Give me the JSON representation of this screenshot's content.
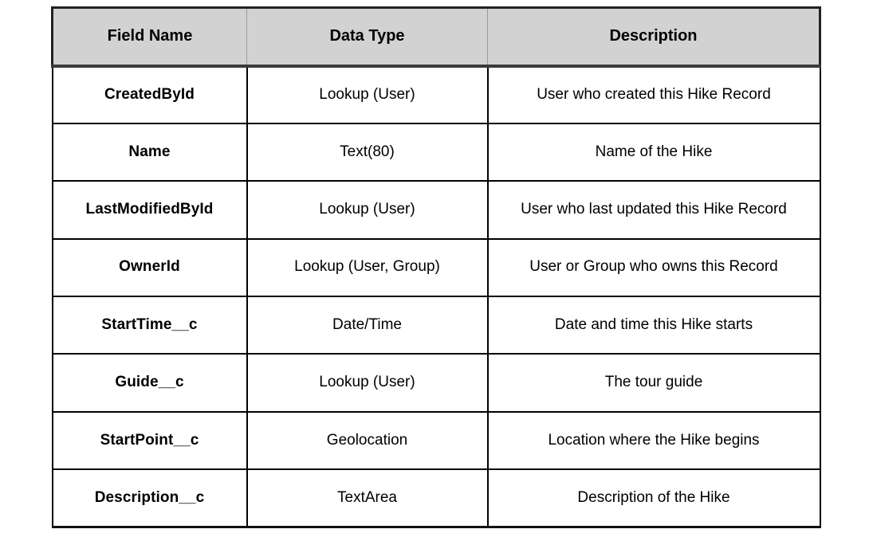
{
  "table": {
    "columns": [
      {
        "key": "field_name",
        "label": "Field Name"
      },
      {
        "key": "data_type",
        "label": "Data Type"
      },
      {
        "key": "description",
        "label": "Description"
      }
    ],
    "header_background": "#d2d2d2",
    "border_color": "#000000",
    "rows": [
      {
        "field_name": "CreatedById",
        "data_type": "Lookup (User)",
        "description": "User who created this Hike Record"
      },
      {
        "field_name": "Name",
        "data_type": "Text(80)",
        "description": "Name of the Hike"
      },
      {
        "field_name": "LastModifiedById",
        "data_type": "Lookup (User)",
        "description": "User who last updated this Hike Record"
      },
      {
        "field_name": "OwnerId",
        "data_type": "Lookup (User, Group)",
        "description": "User or Group who owns this Record"
      },
      {
        "field_name": "StartTime__c",
        "data_type": "Date/Time",
        "description": "Date and time this Hike starts"
      },
      {
        "field_name": "Guide__c",
        "data_type": "Lookup (User)",
        "description": "The tour guide"
      },
      {
        "field_name": "StartPoint__c",
        "data_type": "Geolocation",
        "description": "Location where the Hike begins"
      },
      {
        "field_name": "Description__c",
        "data_type": "TextArea",
        "description": "Description of the Hike"
      }
    ]
  }
}
